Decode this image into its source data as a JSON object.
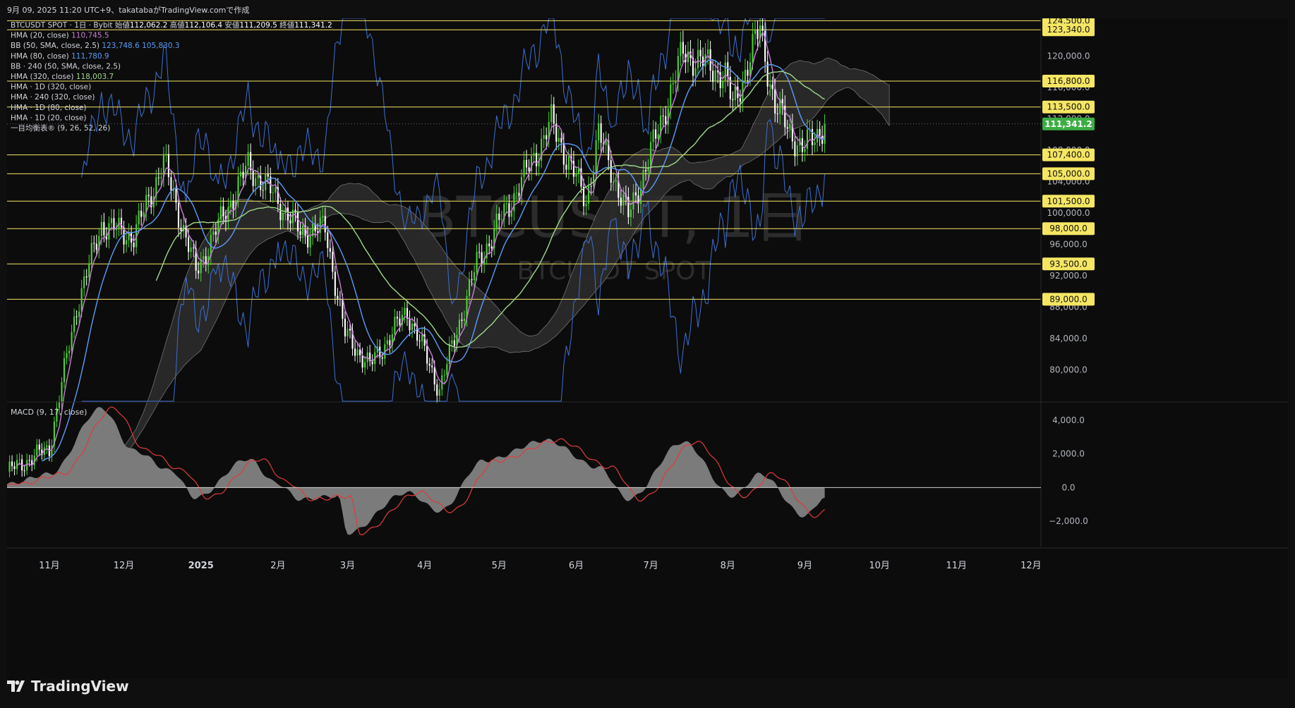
{
  "header": {
    "caption": "9月 09, 2025 11:20 UTC+9、takatabaがTradingView.comで作成"
  },
  "brand": {
    "name": "TradingView"
  },
  "watermark": {
    "line1": "BTCUSDT, 1日",
    "line2": "BTCUSDT SPOT"
  },
  "legend": [
    {
      "text": "BTCUSDT SPOT · 1日 · Bybit",
      "color": "#d1d4dc",
      "ohlc": [
        {
          "label": "始値",
          "value": "112,062.2"
        },
        {
          "label": "高値",
          "value": "112,106.4"
        },
        {
          "label": "安値",
          "value": "111,209.5"
        },
        {
          "label": "終値",
          "value": "111,341.2"
        }
      ]
    },
    {
      "text": "HMA (20, close)",
      "color": "#d1d4dc",
      "values": [
        {
          "v": "110,745.5",
          "color": "#c77dd6"
        }
      ]
    },
    {
      "text": "BB (50, SMA, close, 2.5)",
      "color": "#d1d4dc",
      "values": [
        {
          "v": "123,748.6",
          "color": "#5b9cf6"
        },
        {
          "v": "105,830.3",
          "color": "#5b9cf6"
        }
      ]
    },
    {
      "text": "HMA (80, close)",
      "color": "#d1d4dc",
      "values": [
        {
          "v": "111,780.9",
          "color": "#5b9cf6"
        }
      ]
    },
    {
      "text": "BB · 240 (50, SMA, close, 2.5)",
      "color": "#d1d4dc",
      "values": []
    },
    {
      "text": "HMA (320, close)",
      "color": "#d1d4dc",
      "values": [
        {
          "v": "118,003.7",
          "color": "#9ed98a"
        }
      ]
    },
    {
      "text": "HMA · 1D (320, close)",
      "color": "#d1d4dc",
      "values": []
    },
    {
      "text": "HMA · 240 (320, close)",
      "color": "#d1d4dc",
      "values": []
    },
    {
      "text": "HMA · 1D (80, close)",
      "color": "#d1d4dc",
      "values": []
    },
    {
      "text": "HMA · 1D (20, close)",
      "color": "#d1d4dc",
      "values": []
    },
    {
      "text": "一目均衡表® (9, 26, 52, 26)",
      "color": "#d1d4dc",
      "values": []
    }
  ],
  "macd_label": "MACD (9, 17, close)",
  "colors": {
    "up": "#4cd137",
    "down": "#ffffff",
    "hline": "#f5e663",
    "hma20": "#c77dd6",
    "hma80": "#5b9cf6",
    "hma320": "#9ed98a",
    "bb": "#3d6fd1",
    "cloud": "#2a2a2a",
    "macd": "#7b7b7b",
    "signal": "#e03b3b"
  },
  "chart_data": [
    {
      "type": "candlestick",
      "title": "BTCUSDT, 1日",
      "subtitle": "BTCUSDT SPOT",
      "interval": "1日",
      "xlabels": [
        "11月",
        "12月",
        "2025",
        "2月",
        "3月",
        "4月",
        "5月",
        "6月",
        "7月",
        "8月",
        "9月",
        "10月",
        "11月",
        "12月"
      ],
      "yticks": [
        "80,000.0",
        "84,000.0",
        "88,000.0",
        "92,000.0",
        "96,000.0",
        "100,000.0",
        "104,000.0",
        "108,000.0",
        "112,000.0",
        "116,000.0",
        "120,000.0"
      ],
      "ylim": [
        76000,
        124800
      ],
      "last_price": "111,341.2",
      "horizontal_levels": [
        "124,500.0",
        "123,340.0",
        "116,800.0",
        "113,500.0",
        "107,400.0",
        "105,000.0",
        "101,500.0",
        "98,000.0",
        "93,500.0",
        "89,000.0"
      ],
      "series_keypoints": [
        {
          "date": "10/15",
          "close": 67000
        },
        {
          "date": "11/01",
          "close": 70000
        },
        {
          "date": "11/12",
          "close": 88000
        },
        {
          "date": "11/22",
          "close": 98500
        },
        {
          "date": "12/05",
          "close": 97000
        },
        {
          "date": "12/17",
          "close": 106500
        },
        {
          "date": "12/30",
          "close": 92500
        },
        {
          "date": "01/20",
          "close": 106000
        },
        {
          "date": "01/31",
          "close": 102000
        },
        {
          "date": "02/10",
          "close": 97500
        },
        {
          "date": "02/20",
          "close": 98000
        },
        {
          "date": "02/28",
          "close": 84500
        },
        {
          "date": "03/10",
          "close": 80500
        },
        {
          "date": "03/25",
          "close": 87500
        },
        {
          "date": "04/07",
          "close": 77500
        },
        {
          "date": "04/22",
          "close": 93500
        },
        {
          "date": "05/10",
          "close": 104000
        },
        {
          "date": "05/22",
          "close": 111500
        },
        {
          "date": "06/05",
          "close": 101500
        },
        {
          "date": "06/10",
          "close": 110000
        },
        {
          "date": "06/22",
          "close": 99500
        },
        {
          "date": "07/03",
          "close": 109500
        },
        {
          "date": "07/14",
          "close": 120500
        },
        {
          "date": "07/31",
          "close": 117500
        },
        {
          "date": "08/03",
          "close": 113500
        },
        {
          "date": "08/14",
          "close": 123500
        },
        {
          "date": "08/20",
          "close": 113500
        },
        {
          "date": "08/31",
          "close": 108000
        },
        {
          "date": "09/09",
          "close": 111341
        }
      ],
      "indicators": [
        "HMA (20)",
        "HMA (80)",
        "HMA (320)",
        "BB (50, 2.5)",
        "一目均衡表"
      ]
    },
    {
      "type": "area",
      "title": "MACD (9, 17, close)",
      "yticks": [
        "4,000.0",
        "2,000.0",
        "0.0",
        "−2,000.0"
      ],
      "ylim": [
        -3500,
        5000
      ],
      "series_keypoints": [
        {
          "date": "10/15",
          "value": 200
        },
        {
          "date": "11/01",
          "value": 800
        },
        {
          "date": "11/22",
          "value": 4700
        },
        {
          "date": "12/05",
          "value": 2200
        },
        {
          "date": "12/20",
          "value": 1000
        },
        {
          "date": "12/30",
          "value": -600
        },
        {
          "date": "01/20",
          "value": 1700
        },
        {
          "date": "01/31",
          "value": 300
        },
        {
          "date": "02/10",
          "value": -700
        },
        {
          "date": "02/25",
          "value": -500
        },
        {
          "date": "03/01",
          "value": -2700
        },
        {
          "date": "03/25",
          "value": -300
        },
        {
          "date": "04/07",
          "value": -1400
        },
        {
          "date": "04/25",
          "value": 1600
        },
        {
          "date": "05/20",
          "value": 2800
        },
        {
          "date": "06/10",
          "value": 1200
        },
        {
          "date": "06/22",
          "value": -700
        },
        {
          "date": "07/14",
          "value": 2700
        },
        {
          "date": "08/03",
          "value": -500
        },
        {
          "date": "08/14",
          "value": 800
        },
        {
          "date": "09/01",
          "value": -1700
        },
        {
          "date": "09/09",
          "value": -600
        }
      ]
    }
  ]
}
